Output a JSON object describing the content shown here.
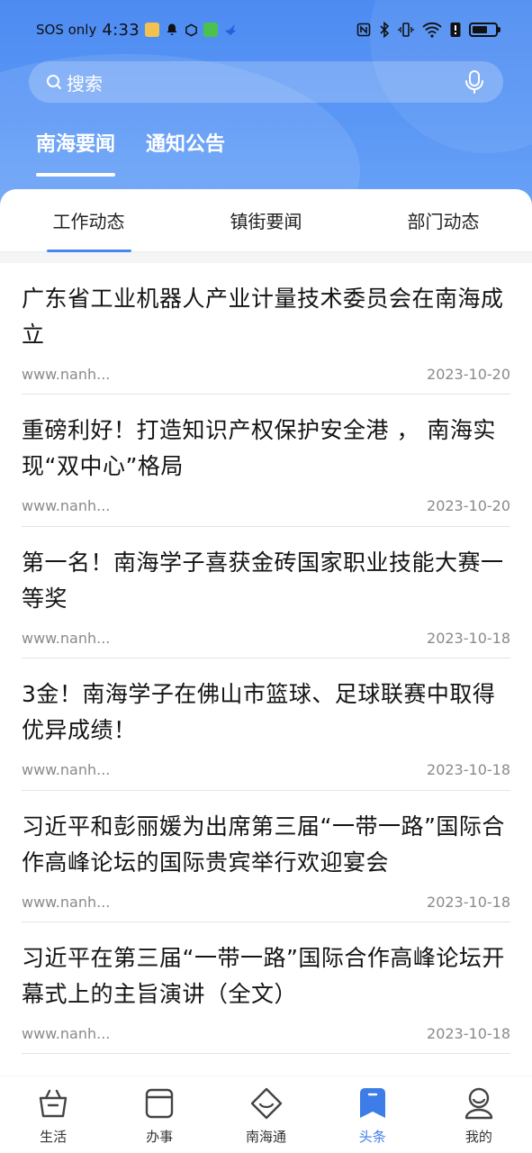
{
  "status_bar": {
    "carrier": "SOS only",
    "time": "4:33"
  },
  "search": {
    "placeholder": "搜索"
  },
  "top_tabs": [
    {
      "label": "南海要闻",
      "active": true
    },
    {
      "label": "通知公告",
      "active": false
    }
  ],
  "sub_tabs": [
    {
      "label": "工作动态",
      "active": true
    },
    {
      "label": "镇街要闻",
      "active": false
    },
    {
      "label": "部门动态",
      "active": false
    }
  ],
  "news": [
    {
      "title": "广东省工业机器人产业计量技术委员会在南海成立",
      "source": "www.nanh...",
      "date": "2023-10-20"
    },
    {
      "title": "重磅利好！打造知识产权保护安全港 ， 南海实现“双中心”格局",
      "source": "www.nanh...",
      "date": "2023-10-20"
    },
    {
      "title": "第一名！南海学子喜获金砖国家职业技能大赛一等奖",
      "source": "www.nanh...",
      "date": "2023-10-18"
    },
    {
      "title": "3金！南海学子在佛山市篮球、足球联赛中取得优异成绩！",
      "source": "www.nanh...",
      "date": "2023-10-18"
    },
    {
      "title": "习近平和彭丽媛为出席第三届“一带一路”国际合作高峰论坛的国际贵宾举行欢迎宴会",
      "source": "www.nanh...",
      "date": "2023-10-18"
    },
    {
      "title": "习近平在第三届“一带一路”国际合作高峰论坛开幕式上的主旨演讲（全文）",
      "source": "www.nanh...",
      "date": "2023-10-18"
    }
  ],
  "bottom_nav": [
    {
      "label": "生活",
      "icon": "basket-icon",
      "active": false
    },
    {
      "label": "办事",
      "icon": "window-icon",
      "active": false
    },
    {
      "label": "南海通",
      "icon": "diamond-icon",
      "active": false
    },
    {
      "label": "头条",
      "icon": "bookmark-icon",
      "active": true
    },
    {
      "label": "我的",
      "icon": "user-icon",
      "active": false
    }
  ],
  "colors": {
    "header_blue": "#5a97f5",
    "accent": "#3c7de8"
  }
}
